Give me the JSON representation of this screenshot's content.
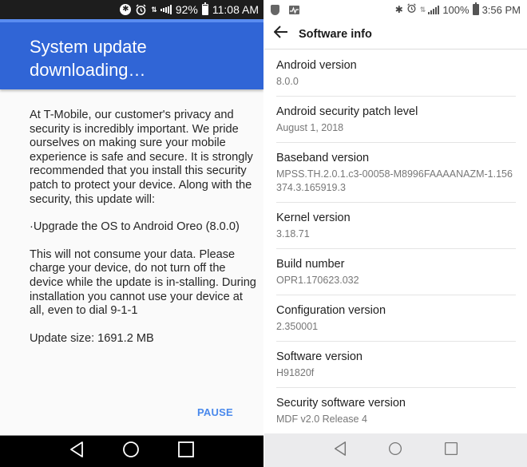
{
  "left_screen": {
    "status_bar": {
      "icons": [
        "bluetooth-icon",
        "alarm-icon",
        "data-arrows-icon",
        "signal-icon"
      ],
      "battery_percent": "92%",
      "battery_level": 0.92,
      "time": "11:08 AM"
    },
    "header": {
      "title": "System update downloading…",
      "color": "#3065d6",
      "progress_fraction": 1.0
    },
    "body": {
      "paragraph_1": "At T-Mobile, our customer's privacy and security is incredibly important. We pride ourselves on making sure your mobile experience is safe and secure. It is strongly recommended that you install this security patch to protect your device. Along with the security, this update will:",
      "bullet": "·Upgrade the OS to Android Oreo (8.0.0)",
      "paragraph_2": "This will not consume your data. Please charge your device, do not turn off the device while the update is in-stalling. During installation you cannot use your device at all, even to dial 9-1-1",
      "update_size": "Update size: 1691.2 MB"
    },
    "pause_label": "PAUSE",
    "accent_color": "#4a89ec",
    "nav": [
      "back-icon",
      "home-icon",
      "recents-icon"
    ]
  },
  "right_screen": {
    "status_bar": {
      "left_icons": [
        "shield-icon",
        "pulse-icon"
      ],
      "right_icons": [
        "bluetooth-icon",
        "alarm-icon",
        "data-arrows-icon",
        "signal-icon"
      ],
      "battery_percent": "100%",
      "time": "3:56 PM"
    },
    "appbar": {
      "title": "Software info"
    },
    "items": [
      {
        "label": "Android version",
        "value": "8.0.0"
      },
      {
        "label": "Android security patch level",
        "value": "August 1, 2018"
      },
      {
        "label": "Baseband version",
        "value": "MPSS.TH.2.0.1.c3-00058-M8996FAAAANAZM-1.156374.3.165919.3"
      },
      {
        "label": "Kernel version",
        "value": "3.18.71"
      },
      {
        "label": "Build number",
        "value": "OPR1.170623.032"
      },
      {
        "label": "Configuration version",
        "value": "2.350001"
      },
      {
        "label": "Software version",
        "value": "H91820f"
      },
      {
        "label": "Security software version",
        "value": "MDF v2.0 Release 4"
      }
    ],
    "nav": [
      "back-icon",
      "home-icon",
      "recents-icon"
    ]
  }
}
